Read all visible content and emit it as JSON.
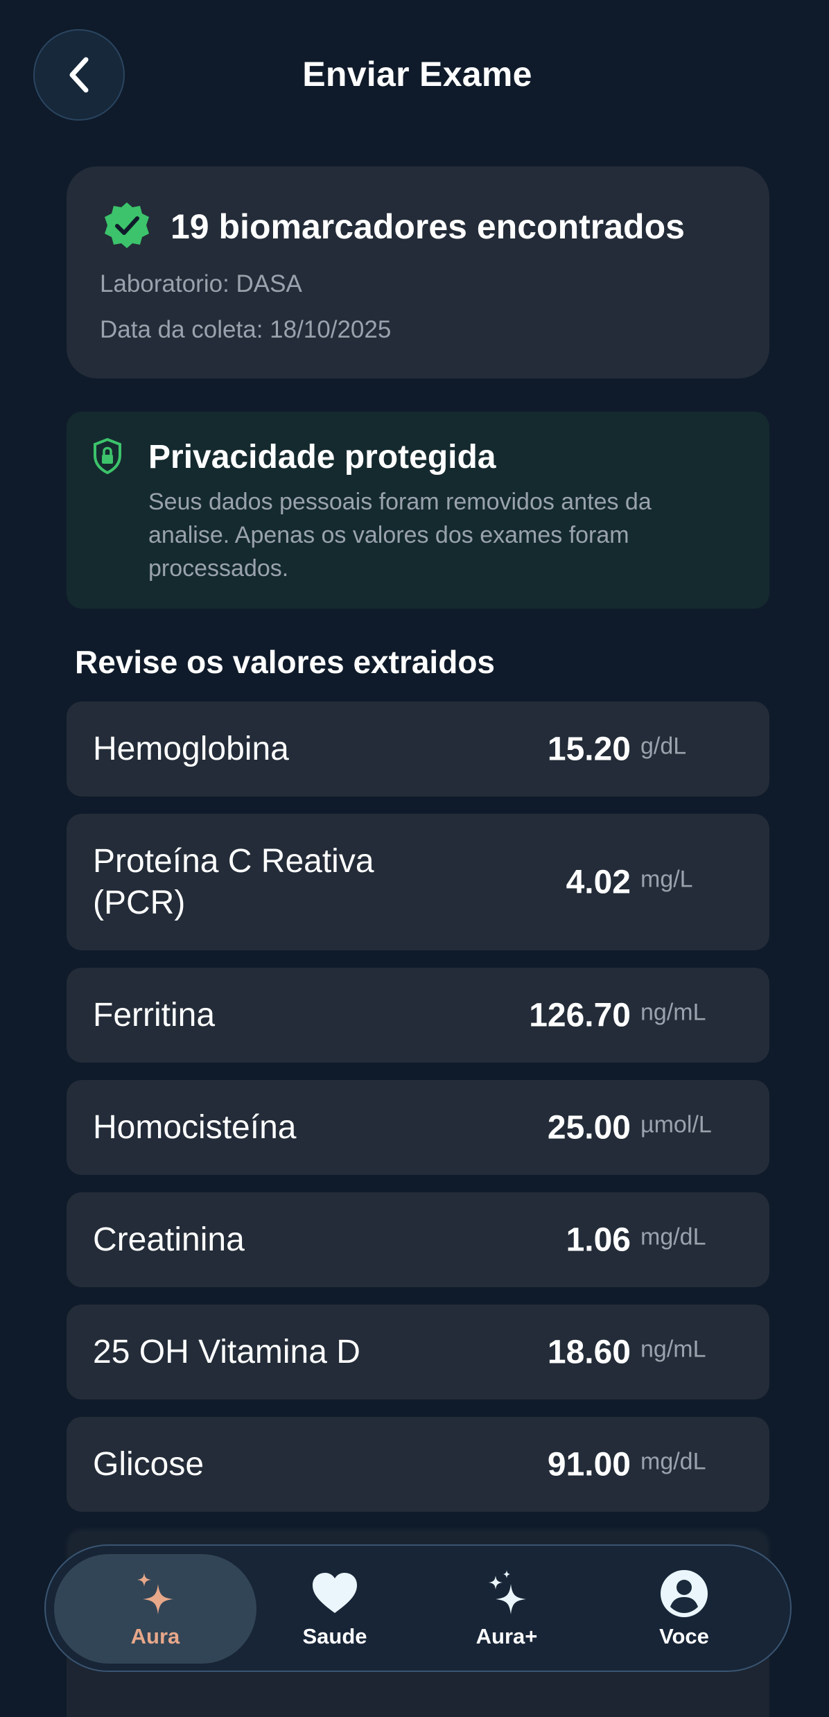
{
  "header": {
    "title": "Enviar Exame"
  },
  "summary": {
    "title": "19 biomarcadores encontrados",
    "lab": "Laboratorio: DASA",
    "date": "Data da coleta: 18/10/2025"
  },
  "privacy": {
    "title": "Privacidade protegida",
    "text": "Seus dados pessoais foram removidos antes da analise. Apenas os valores dos exames foram processados."
  },
  "review": {
    "title": "Revise os valores extraidos",
    "items": [
      {
        "name": "Hemoglobina",
        "value": "15.20",
        "unit": "g/dL"
      },
      {
        "name": "Proteína C Reativa (PCR)",
        "value": "4.02",
        "unit": "mg/L"
      },
      {
        "name": "Ferritina",
        "value": "126.70",
        "unit": "ng/mL"
      },
      {
        "name": "Homocisteína",
        "value": "25.00",
        "unit": "µmol/L"
      },
      {
        "name": "Creatinina",
        "value": "1.06",
        "unit": "mg/dL"
      },
      {
        "name": "25 OH Vitamina D",
        "value": "18.60",
        "unit": "ng/mL"
      },
      {
        "name": "Glicose",
        "value": "91.00",
        "unit": "mg/dL"
      }
    ]
  },
  "nav": {
    "items": [
      {
        "label": "Aura",
        "icon": "sparkle-icon",
        "active": true
      },
      {
        "label": "Saude",
        "icon": "heart-icon",
        "active": false
      },
      {
        "label": "Aura+",
        "icon": "sparkles-icon",
        "active": false
      },
      {
        "label": "Voce",
        "icon": "user-icon",
        "active": false
      }
    ]
  },
  "colors": {
    "background": "#0f1b2a",
    "card": "#232c38",
    "privacy_card": "#152a2f",
    "accent_green": "#3cc36b",
    "active_nav": "#e8a88a"
  }
}
